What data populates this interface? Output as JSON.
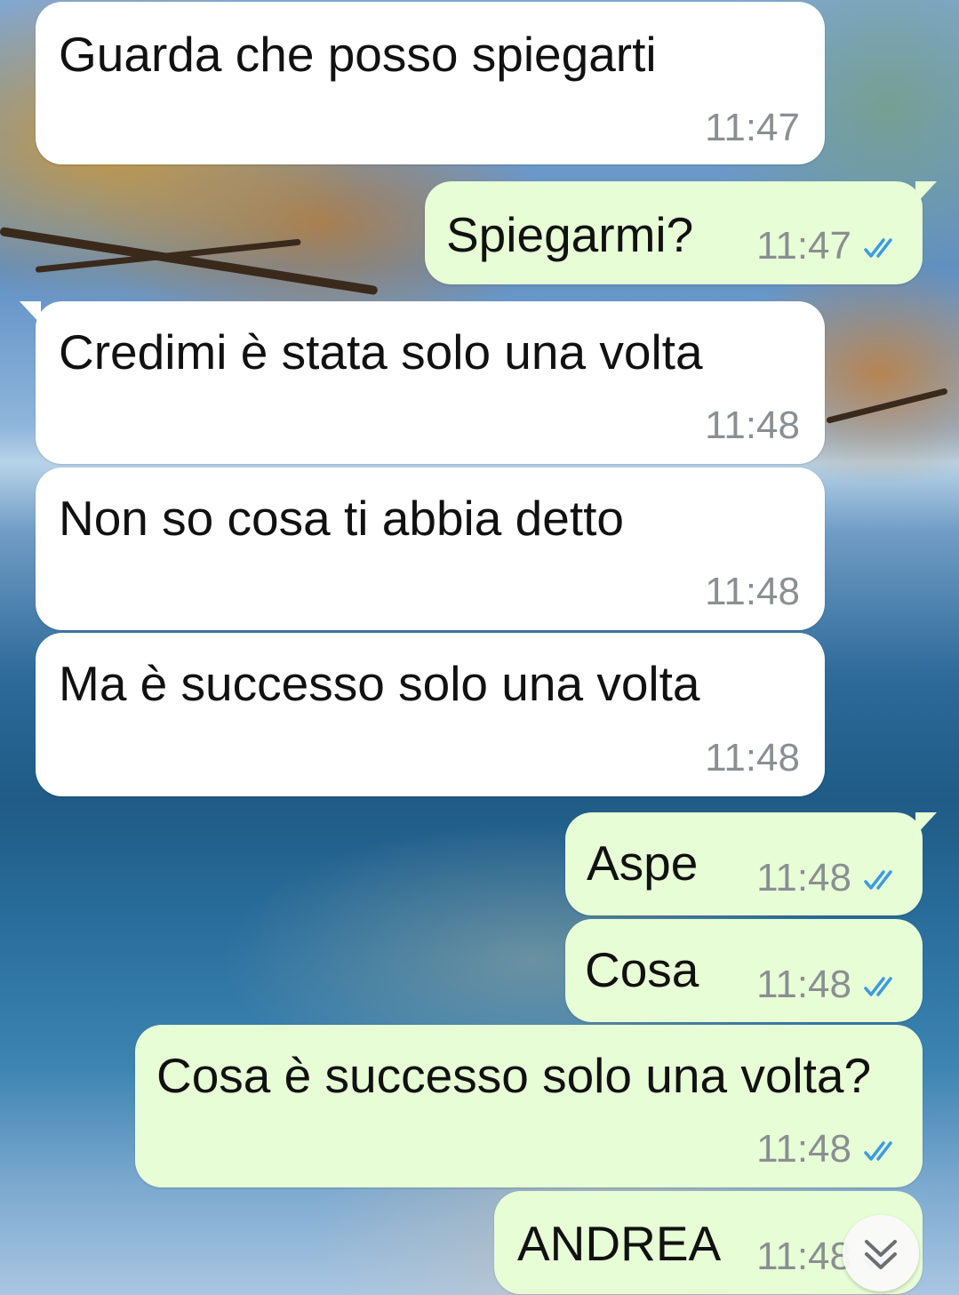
{
  "colors": {
    "incoming_bubble": "#ffffff",
    "outgoing_bubble": "#e7fdd6",
    "read_ticks": "#3d9be0",
    "timestamp": "#8a8f92"
  },
  "icons": {
    "read_receipt": "double-check-icon",
    "scroll_down": "chevron-double-down-icon"
  },
  "messages": [
    {
      "direction": "incoming",
      "text": "Guarda che posso spiegarti",
      "time": "11:47"
    },
    {
      "direction": "outgoing",
      "text": "Spiegarmi?",
      "time": "11:47",
      "status": "read"
    },
    {
      "direction": "incoming",
      "text": "Credimi è stata solo una volta",
      "time": "11:48"
    },
    {
      "direction": "incoming",
      "text": "Non so cosa ti abbia detto",
      "time": "11:48"
    },
    {
      "direction": "incoming",
      "text": "Ma è successo solo una volta",
      "time": "11:48"
    },
    {
      "direction": "outgoing",
      "text": "Aspe",
      "time": "11:48",
      "status": "read"
    },
    {
      "direction": "outgoing",
      "text": "Cosa",
      "time": "11:48",
      "status": "read"
    },
    {
      "direction": "outgoing",
      "text": "Cosa è successo solo una volta?",
      "time": "11:48",
      "status": "read"
    },
    {
      "direction": "outgoing",
      "text": "ANDREA",
      "time": "11:48",
      "status": "read"
    }
  ]
}
